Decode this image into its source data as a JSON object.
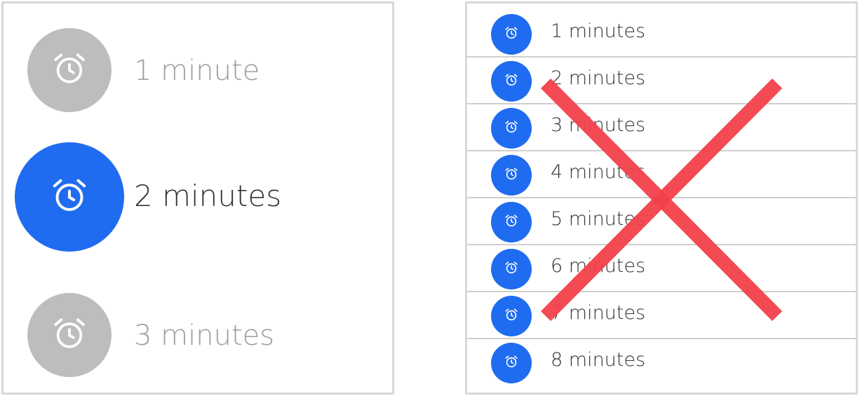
{
  "left_picker": {
    "items": [
      {
        "label": "1 minute",
        "state": "inactive",
        "icon": "alarm-clock-icon"
      },
      {
        "label": "2 minutes",
        "state": "selected",
        "icon": "alarm-clock-icon"
      },
      {
        "label": "3 minutes",
        "state": "inactive",
        "icon": "alarm-clock-icon"
      }
    ]
  },
  "right_list": {
    "items": [
      {
        "label": "1 minutes",
        "icon": "alarm-clock-icon"
      },
      {
        "label": "2 minutes",
        "icon": "alarm-clock-icon"
      },
      {
        "label": "3 minutes",
        "icon": "alarm-clock-icon"
      },
      {
        "label": "4 minutes",
        "icon": "alarm-clock-icon"
      },
      {
        "label": "5 minutes",
        "icon": "alarm-clock-icon"
      },
      {
        "label": "6 minutes",
        "icon": "alarm-clock-icon"
      },
      {
        "label": "7 minutes",
        "icon": "alarm-clock-icon"
      },
      {
        "label": "8 minutes",
        "icon": "alarm-clock-icon"
      }
    ],
    "overlay": "red-x-cross"
  },
  "colors": {
    "accent": "#1f6cf0",
    "inactive_circle": "#bdbdbd",
    "inactive_text": "#9e9e9e",
    "active_text": "#333333",
    "cross": "#f2404a",
    "border": "#d9d9d9"
  }
}
